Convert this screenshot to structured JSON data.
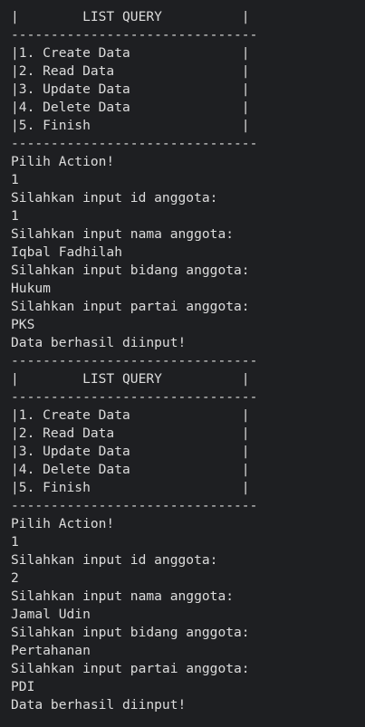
{
  "terminal": {
    "lines": [
      "-------------------------------",
      "|        LIST QUERY          |",
      "-------------------------------",
      "|1. Create Data              |",
      "|2. Read Data                |",
      "|3. Update Data              |",
      "|4. Delete Data              |",
      "|5. Finish                   |",
      "-------------------------------",
      "Pilih Action!",
      "1",
      "Silahkan input id anggota:",
      "1",
      "Silahkan input nama anggota:",
      "Iqbal Fadhilah",
      "Silahkan input bidang anggota:",
      "Hukum",
      "Silahkan input partai anggota:",
      "PKS",
      "Data berhasil diinput!",
      "-------------------------------",
      "|        LIST QUERY          |",
      "-------------------------------",
      "|1. Create Data              |",
      "|2. Read Data                |",
      "|3. Update Data              |",
      "|4. Delete Data              |",
      "|5. Finish                   |",
      "-------------------------------",
      "Pilih Action!",
      "1",
      "Silahkan input id anggota:",
      "2",
      "Silahkan input nama anggota:",
      "Jamal Udin",
      "Silahkan input bidang anggota:",
      "Pertahanan",
      "Silahkan input partai anggota:",
      "PDI",
      "Data berhasil diinput!"
    ]
  }
}
